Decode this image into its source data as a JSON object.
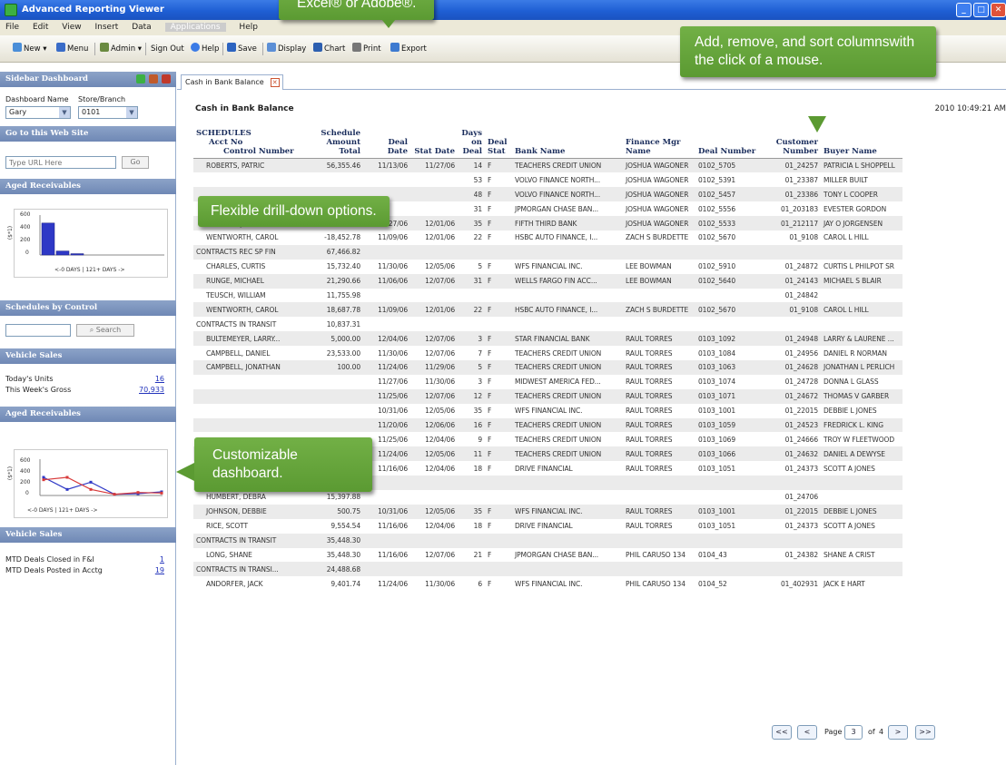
{
  "window": {
    "title": "Advanced Reporting Viewer"
  },
  "menu": {
    "items": [
      "File",
      "Edit",
      "View",
      "Insert",
      "Data",
      "Applications",
      "Help"
    ]
  },
  "toolbar": {
    "new": "New",
    "menu": "Menu",
    "admin": "Admin",
    "sign_out": "Sign Out",
    "help": "Help",
    "save": "Save",
    "display": "Display",
    "chart": "Chart",
    "print": "Print",
    "export": "Export"
  },
  "sidebar": {
    "dashboard_title": "Sidebar Dashboard",
    "dashboard_name_label": "Dashboard Name",
    "store_label": "Store/Branch",
    "dashboard_value": "Gary",
    "store_value": "0101",
    "web_site_title": "Go to this Web Site",
    "url_placeholder": "Type URL Here",
    "go_label": "Go",
    "aged1_title": "Aged Receivables",
    "aged_x_label": "<-0 DAYS | 121+ DAYS ->",
    "aged_y_label": "($*1)",
    "aged_y_ticks": [
      "600",
      "400",
      "200",
      "0"
    ],
    "sched_title": "Schedules by Control",
    "search_label": "Search",
    "vehicle1_title": "Vehicle Sales",
    "todays_units_label": "Today's Units",
    "todays_units_value": "16",
    "weeks_gross_label": "This Week's Gross",
    "weeks_gross_value": "70,933",
    "aged2_title": "Aged Receivables",
    "vehicle2_title": "Vehicle Sales",
    "mtd_closed_label": "MTD Deals Closed in F&I",
    "mtd_closed_value": "1",
    "mtd_posted_label": "MTD Deals Posted in Acctg",
    "mtd_posted_value": "19"
  },
  "report": {
    "tab_label": "Cash in Bank Balance",
    "title": "Cash in Bank Balance",
    "date": "2010 10:49:21 AM",
    "headers": {
      "schedules": "SCHEDULES",
      "acct": "Acct No",
      "control": "Control Number",
      "amount": "Schedule Amount Total",
      "deal_date": "Deal Date",
      "stat_date": "Stat Date",
      "days": "Days on Deal",
      "deal_stat": "Deal Stat",
      "bank": "Bank Name",
      "fin_mgr": "Finance Mgr Name",
      "deal_no": "Deal Number",
      "cust_no": "Customer Number",
      "buyer": "Buyer Name"
    },
    "rows": [
      [
        "ROBERTS, PATRIC",
        "56,355.46",
        "11/13/06",
        "11/27/06",
        "14",
        "F",
        "TEACHERS CREDIT UNION",
        "JOSHUA WAGONER",
        "0102_5705",
        "01_24257",
        "PATRICIA L SHOPPELL"
      ],
      [
        "",
        "",
        "",
        "",
        "53",
        "F",
        "VOLVO FINANCE NORTH...",
        "JOSHUA WAGONER",
        "0102_5391",
        "01_23387",
        "MILLER BUILT"
      ],
      [
        "",
        "",
        "",
        "",
        "48",
        "F",
        "VOLVO FINANCE NORTH...",
        "JOSHUA WAGONER",
        "0102_5457",
        "01_23386",
        "TONY L COOPER"
      ],
      [
        "",
        "",
        "",
        "",
        "31",
        "F",
        "JPMORGAN CHASE BAN...",
        "JOSHUA WAGONER",
        "0102_5556",
        "01_203183",
        "EVESTER GORDON"
      ],
      [
        "WELLING, JAY",
        "64,980.21",
        "10/27/06",
        "12/01/06",
        "35",
        "F",
        "FIFTH THIRD BANK",
        "JOSHUA WAGONER",
        "0102_5533",
        "01_212117",
        "JAY O JORGENSEN"
      ],
      [
        "WENTWORTH, CAROL",
        "-18,452.78",
        "11/09/06",
        "12/01/06",
        "22",
        "F",
        "HSBC AUTO FINANCE, I...",
        "ZACH S BURDETTE",
        "0102_5670",
        "01_9108",
        "CAROL L HILL"
      ],
      [
        "CONTRACTS REC SP FIN",
        "67,466.82",
        "",
        "",
        "",
        "",
        "",
        "",
        "",
        "",
        ""
      ],
      [
        "CHARLES, CURTIS",
        "15,732.40",
        "11/30/06",
        "12/05/06",
        "5",
        "F",
        "WFS FINANCIAL INC.",
        "LEE BOWMAN",
        "0102_5910",
        "01_24872",
        "CURTIS L PHILPOT SR"
      ],
      [
        "RUNGE, MICHAEL",
        "21,290.66",
        "11/06/06",
        "12/07/06",
        "31",
        "F",
        "WELLS FARGO FIN ACC...",
        "LEE BOWMAN",
        "0102_5640",
        "01_24143",
        "MICHAEL S BLAIR"
      ],
      [
        "TEUSCH, WILLIAM",
        "11,755.98",
        "",
        "",
        "",
        "",
        "",
        "",
        "",
        "01_24842",
        ""
      ],
      [
        "WENTWORTH, CAROL",
        "18,687.78",
        "11/09/06",
        "12/01/06",
        "22",
        "F",
        "HSBC AUTO FINANCE, I...",
        "ZACH S BURDETTE",
        "0102_5670",
        "01_9108",
        "CAROL L HILL"
      ],
      [
        "CONTRACTS IN TRANSIT",
        "10,837.31",
        "",
        "",
        "",
        "",
        "",
        "",
        "",
        "",
        ""
      ],
      [
        "BULTEMEYER, LARRY...",
        "5,000.00",
        "12/04/06",
        "12/07/06",
        "3",
        "F",
        "STAR FINANCIAL BANK",
        "RAUL TORRES",
        "0103_1092",
        "01_24948",
        "LARRY & LAURENE ..."
      ],
      [
        "CAMPBELL, DANIEL",
        "23,533.00",
        "11/30/06",
        "12/07/06",
        "7",
        "F",
        "TEACHERS CREDIT UNION",
        "RAUL TORRES",
        "0103_1084",
        "01_24956",
        "DANIEL R NORMAN"
      ],
      [
        "CAMPBELL, JONATHAN",
        "100.00",
        "11/24/06",
        "11/29/06",
        "5",
        "F",
        "TEACHERS CREDIT UNION",
        "RAUL TORRES",
        "0103_1063",
        "01_24628",
        "JONATHAN L PERLICH"
      ],
      [
        "",
        "",
        "11/27/06",
        "11/30/06",
        "3",
        "F",
        "MIDWEST AMERICA FED...",
        "RAUL TORRES",
        "0103_1074",
        "01_24728",
        "DONNA L GLASS"
      ],
      [
        "",
        "",
        "11/25/06",
        "12/07/06",
        "12",
        "F",
        "TEACHERS CREDIT UNION",
        "RAUL TORRES",
        "0103_1071",
        "01_24672",
        "THOMAS V GARBER"
      ],
      [
        "",
        "",
        "10/31/06",
        "12/05/06",
        "35",
        "F",
        "WFS FINANCIAL INC.",
        "RAUL TORRES",
        "0103_1001",
        "01_22015",
        "DEBBIE L JONES"
      ],
      [
        "",
        "",
        "11/20/06",
        "12/06/06",
        "16",
        "F",
        "TEACHERS CREDIT UNION",
        "RAUL TORRES",
        "0103_1059",
        "01_24523",
        "FREDRICK L. KING"
      ],
      [
        "",
        "",
        "11/25/06",
        "12/04/06",
        "9",
        "F",
        "TEACHERS CREDIT UNION",
        "RAUL TORRES",
        "0103_1069",
        "01_24666",
        "TROY W FLEETWOOD"
      ],
      [
        "",
        "",
        "11/24/06",
        "12/05/06",
        "11",
        "F",
        "TEACHERS CREDIT UNION",
        "RAUL TORRES",
        "0103_1066",
        "01_24632",
        "DANIEL A DEWYSE"
      ],
      [
        "RICE, SCOTT",
        "-9,454.54",
        "11/16/06",
        "12/04/06",
        "18",
        "F",
        "DRIVE FINANCIAL",
        "RAUL TORRES",
        "0103_1051",
        "01_24373",
        "SCOTT A JONES"
      ],
      [
        "CONTRACTS IN TRANSI...",
        "25,453.17",
        "",
        "",
        "",
        "",
        "",
        "",
        "",
        "",
        ""
      ],
      [
        "HUMBERT, DEBRA",
        "15,397.88",
        "",
        "",
        "",
        "",
        "",
        "",
        "",
        "01_24706",
        ""
      ],
      [
        "JOHNSON, DEBBIE",
        "500.75",
        "10/31/06",
        "12/05/06",
        "35",
        "F",
        "WFS FINANCIAL INC.",
        "RAUL TORRES",
        "0103_1001",
        "01_22015",
        "DEBBIE L JONES"
      ],
      [
        "RICE, SCOTT",
        "9,554.54",
        "11/16/06",
        "12/04/06",
        "18",
        "F",
        "DRIVE FINANCIAL",
        "RAUL TORRES",
        "0103_1051",
        "01_24373",
        "SCOTT A JONES"
      ],
      [
        "CONTRACTS IN TRANSIT",
        "35,448.30",
        "",
        "",
        "",
        "",
        "",
        "",
        "",
        "",
        ""
      ],
      [
        "LONG, SHANE",
        "35,448.30",
        "11/16/06",
        "12/07/06",
        "21",
        "F",
        "JPMORGAN CHASE BAN...",
        "PHIL CARUSO 134",
        "0104_43",
        "01_24382",
        "SHANE A CRIST"
      ],
      [
        "CONTRACTS IN TRANSI...",
        "24,488.68",
        "",
        "",
        "",
        "",
        "",
        "",
        "",
        "",
        ""
      ],
      [
        "ANDORFER, JACK",
        "9,401.74",
        "11/24/06",
        "11/30/06",
        "6",
        "F",
        "WFS FINANCIAL INC.",
        "PHIL CARUSO 134",
        "0104_52",
        "01_402931",
        "JACK E HART"
      ]
    ],
    "group_rows": [
      6,
      11,
      22,
      26,
      28
    ]
  },
  "pager": {
    "first": "<<",
    "prev": "<",
    "page_label": "Page",
    "page_value": "3",
    "of_label": "of",
    "total": "4",
    "next": ">",
    "last": ">>"
  },
  "callouts": {
    "top": "Excel® or Adobe®.",
    "columns": "Add, remove, and sort columnswith the click of a mouse.",
    "drill": "Flexible drill-down options.",
    "dashboard": "Customizable dashboard."
  },
  "aged1_chart": {
    "type": "bar",
    "values": [
      480,
      60,
      20
    ],
    "ylim": [
      0,
      600
    ]
  },
  "aged2_chart": {
    "type": "line",
    "series": [
      {
        "values": [
          300,
          100,
          220,
          20,
          30,
          60
        ]
      },
      {
        "values": [
          260,
          300,
          100,
          20,
          50,
          40
        ]
      }
    ],
    "ylim": [
      0,
      600
    ]
  },
  "colors": {
    "title_blue": "#1f5fd4",
    "callout_green": "#5b9a32",
    "header_blue": "#6f88b5"
  }
}
